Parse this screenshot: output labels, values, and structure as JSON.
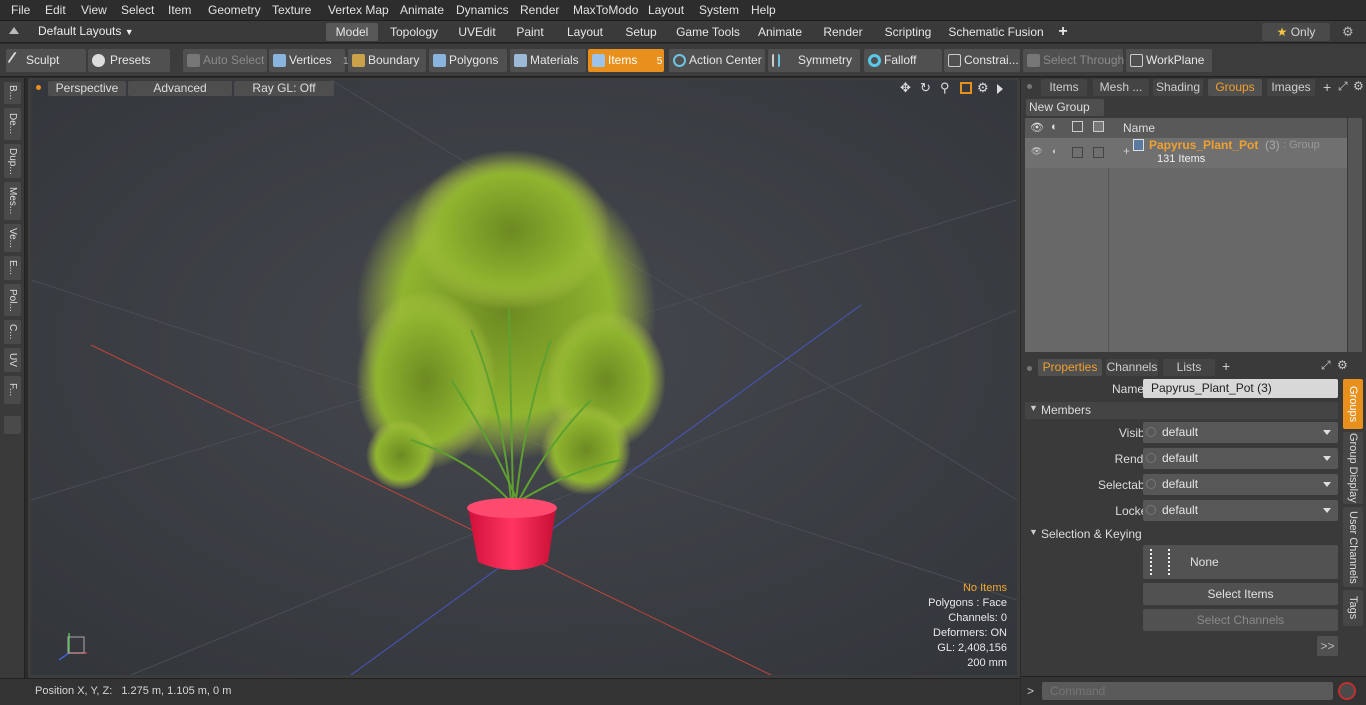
{
  "menu": [
    "File",
    "Edit",
    "View",
    "Select",
    "Item",
    "Geometry",
    "Texture",
    "Vertex Map",
    "Animate",
    "Dynamics",
    "Render",
    "MaxToModo",
    "Layout",
    "System",
    "Help"
  ],
  "layout_bar": {
    "layouts_label": "Default Layouts",
    "tabs": [
      "Model",
      "Topology",
      "UVEdit",
      "Paint",
      "Layout",
      "Setup",
      "Game Tools",
      "Animate",
      "Render",
      "Scripting",
      "Schematic Fusion"
    ],
    "active_tab": "Model",
    "add": "+",
    "only_label": "Only",
    "star": "★"
  },
  "toolbar": {
    "sculpt": "Sculpt",
    "presets": "Presets",
    "auto_select": "Auto Select",
    "vertices": "Vertices",
    "vertices_count": "1",
    "boundary": "Boundary",
    "polygons": "Polygons",
    "materials": "Materials",
    "items": "Items",
    "items_count": "5",
    "action_center": "Action Center",
    "symmetry": "Symmetry",
    "falloff": "Falloff",
    "constraints": "Constrai...",
    "select_through": "Select Through",
    "workplane": "WorkPlane"
  },
  "left_tabs": [
    "B...",
    "De...",
    "Dup...",
    "Mes...",
    "Ve...",
    "E...",
    "Pol...",
    "C...",
    "UV",
    "F..."
  ],
  "viewport": {
    "perspective": "Perspective",
    "advanced": "Advanced",
    "raygl": "Ray GL: Off",
    "stats": {
      "no_items": "No Items",
      "polygons": "Polygons : Face",
      "channels": "Channels: 0",
      "deformers": "Deformers: ON",
      "gl": "GL: 2,408,156",
      "scale": "200 mm"
    }
  },
  "status": {
    "position_label": "Position X, Y, Z:",
    "position_value": "1.275 m, 1.105 m, 0 m"
  },
  "groups_panel": {
    "tabs": [
      "Items",
      "Mesh ...",
      "Shading",
      "Groups",
      "Images"
    ],
    "active_tab": "Groups",
    "new_group": "New Group",
    "name_col": "Name",
    "group_name": "Papyrus_Plant_Pot",
    "group_count": "(3)",
    "group_type": ": Group",
    "group_items": "131 Items"
  },
  "properties_panel": {
    "tabs": [
      "Properties",
      "Channels",
      "Lists"
    ],
    "active_tab": "Properties",
    "name_label": "Name",
    "name_value": "Papyrus_Plant_Pot (3)",
    "members_header": "Members",
    "rows": [
      {
        "label": "Visible",
        "value": "default"
      },
      {
        "label": "Render",
        "value": "default"
      },
      {
        "label": "Selectable",
        "value": "default"
      },
      {
        "label": "Locked",
        "value": "default"
      }
    ],
    "selkey_header": "Selection & Keying",
    "none_label": "None",
    "select_items": "Select Items",
    "select_channels": "Select Channels",
    "more": ">>",
    "side_tabs": [
      "Groups",
      "Group Display",
      "User Channels",
      "Tags"
    ]
  },
  "command": {
    "prompt": ">",
    "placeholder": "Command"
  },
  "colors": {
    "accent": "#e8901b",
    "pot": "#ff1f4a",
    "foliage": "#8fb52f"
  }
}
